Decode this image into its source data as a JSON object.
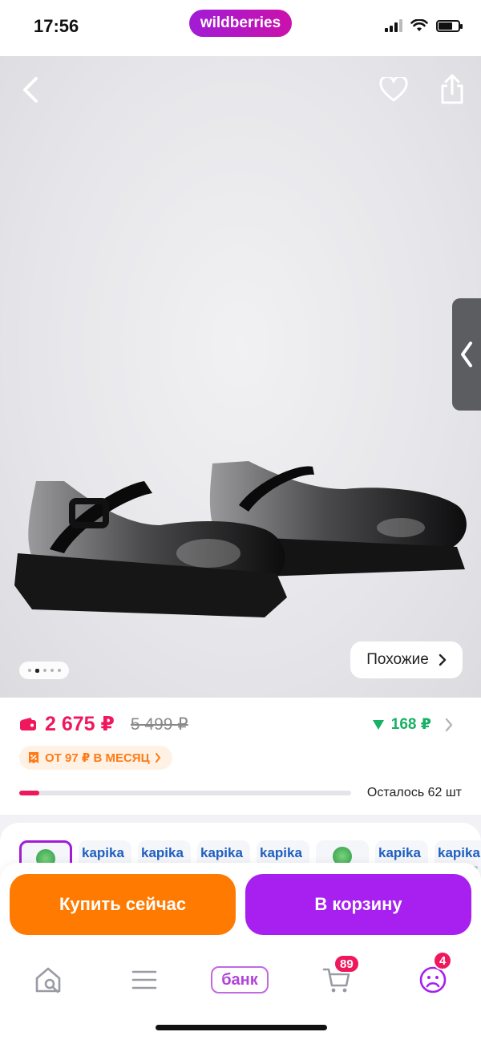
{
  "status_bar": {
    "time": "17:56",
    "brand": "wildberries"
  },
  "product": {
    "similar_label": "Похожие",
    "gallery_pages": 5,
    "gallery_current": 2
  },
  "pricing": {
    "price": "2 675 ₽",
    "old_price": "5 499 ₽",
    "cashback": "168 ₽",
    "installment": "ОТ 97 ₽ В МЕСЯЦ",
    "stock_label": "Осталось 62 шт",
    "stock_progress": 0.06
  },
  "thumbnails": [
    {
      "logo": "",
      "selected": true
    },
    {
      "logo": "kapika",
      "selected": false
    },
    {
      "logo": "kapika",
      "selected": false
    },
    {
      "logo": "kapika",
      "selected": false
    },
    {
      "logo": "kapika",
      "selected": false
    },
    {
      "logo": "",
      "selected": false
    },
    {
      "logo": "kapika",
      "selected": false
    },
    {
      "logo": "kapika",
      "selected": false
    }
  ],
  "actions": {
    "buy_now": "Купить сейчас",
    "add_to_cart": "В корзину"
  },
  "tabbar": {
    "bank_label": "банк",
    "cart_badge": "89",
    "profile_badge": "4"
  },
  "colors": {
    "brand": "#a11cd6",
    "price": "#f0185d",
    "cashback": "#17b064",
    "buy_button": "#ff7a00",
    "cart_button": "#a720f0"
  },
  "icons": [
    "back-icon",
    "heart-icon",
    "share-icon",
    "chevron-left-icon",
    "wallet-icon",
    "down-arrow-icon",
    "chevron-right-icon",
    "home-search-icon",
    "menu-icon",
    "cart-icon",
    "profile-icon"
  ]
}
